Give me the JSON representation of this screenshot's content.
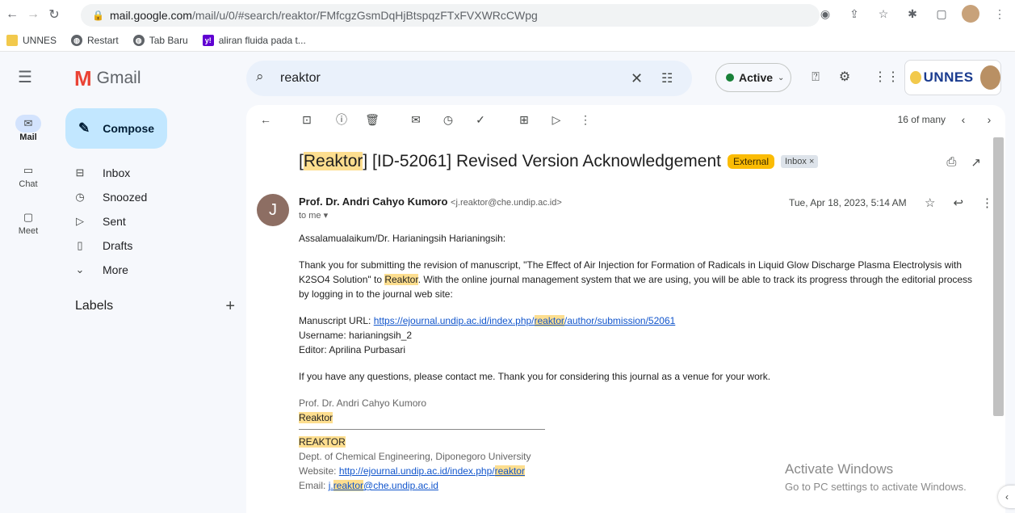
{
  "browser": {
    "url_host": "mail.google.com",
    "url_path": "/mail/u/0/#search/reaktor/FMfcgzGsmDqHjBtspqzFTxFVXWRcCWpg",
    "bookmarks": [
      {
        "label": "UNNES",
        "icon": "folder-icon",
        "color": "#f2c94c"
      },
      {
        "label": "Restart",
        "icon": "globe-icon",
        "color": "#5f6368"
      },
      {
        "label": "Tab Baru",
        "icon": "globe-icon",
        "color": "#5f6368"
      },
      {
        "label": "aliran fluida pada t...",
        "icon": "yahoo-icon",
        "color": "#6001d2"
      }
    ]
  },
  "gmail": {
    "brand": "Gmail",
    "search_value": "reaktor",
    "status": "Active",
    "org_name": "UNNES",
    "rail": [
      {
        "label": "Mail",
        "icon": "mail-icon",
        "active": true
      },
      {
        "label": "Chat",
        "icon": "chat-icon",
        "active": false
      },
      {
        "label": "Meet",
        "icon": "video-icon",
        "active": false
      }
    ],
    "compose_label": "Compose",
    "folders": [
      {
        "label": "Inbox",
        "icon": "inbox-icon"
      },
      {
        "label": "Snoozed",
        "icon": "clock-icon"
      },
      {
        "label": "Sent",
        "icon": "send-icon"
      },
      {
        "label": "Drafts",
        "icon": "draft-icon"
      },
      {
        "label": "More",
        "icon": "chevron-down-icon"
      }
    ],
    "labels_heading": "Labels",
    "pager_text": "16 of many"
  },
  "message": {
    "subject_highlight": "Reaktor",
    "subject_rest": "[ID-52061] Revised Version Acknowledgement",
    "badge_external": "External",
    "badge_inbox": "Inbox ×",
    "sender_initial": "J",
    "sender_name": "Prof. Dr. Andri Cahyo Kumoro",
    "sender_email": "<j.reaktor@che.undip.ac.id>",
    "to_text": "to me ▾",
    "date": "Tue, Apr 18, 2023, 5:14 AM",
    "greeting": "Assalamualaikum/Dr. Harianingsih Harianingsih:",
    "para1_a": "Thank you for submitting the revision of manuscript, \"The Effect of Air Injection for Formation of Radicals in Liquid Glow Discharge Plasma Electrolysis with K2SO4 Solution\" to ",
    "para1_hl": "Reaktor",
    "para1_b": ". With the online journal management system that we are using, you will be able to track its progress through the editorial process by logging in to the journal web site:",
    "ms_url_label": "Manuscript URL: ",
    "ms_url_a": "https://ejournal.undip.ac.id/index.php/",
    "ms_url_hl": "reaktor",
    "ms_url_b": "/author/submission/52061",
    "username": "Username: harianingsih_2",
    "editor": "Editor: Aprilina Purbasari",
    "para2": "If you have any questions, please contact me. Thank you for considering this journal as a venue for your work.",
    "sig_name": "Prof. Dr. Andri Cahyo Kumoro",
    "sig_journal": "Reaktor",
    "sig_title": "REAKTOR",
    "sig_dept": "Dept. of Chemical Engineering, Diponegoro University",
    "sig_web_label": "Website: ",
    "sig_web_a": "http://ejournal.undip.ac.id/index.php/",
    "sig_web_hl": "reaktor",
    "sig_email_label": "Email: ",
    "sig_email_a": "j.",
    "sig_email_hl": "reaktor",
    "sig_email_b": "@che.undip.ac.id"
  },
  "watermark": {
    "title": "Activate Windows",
    "subtitle": "Go to PC settings to activate Windows."
  }
}
